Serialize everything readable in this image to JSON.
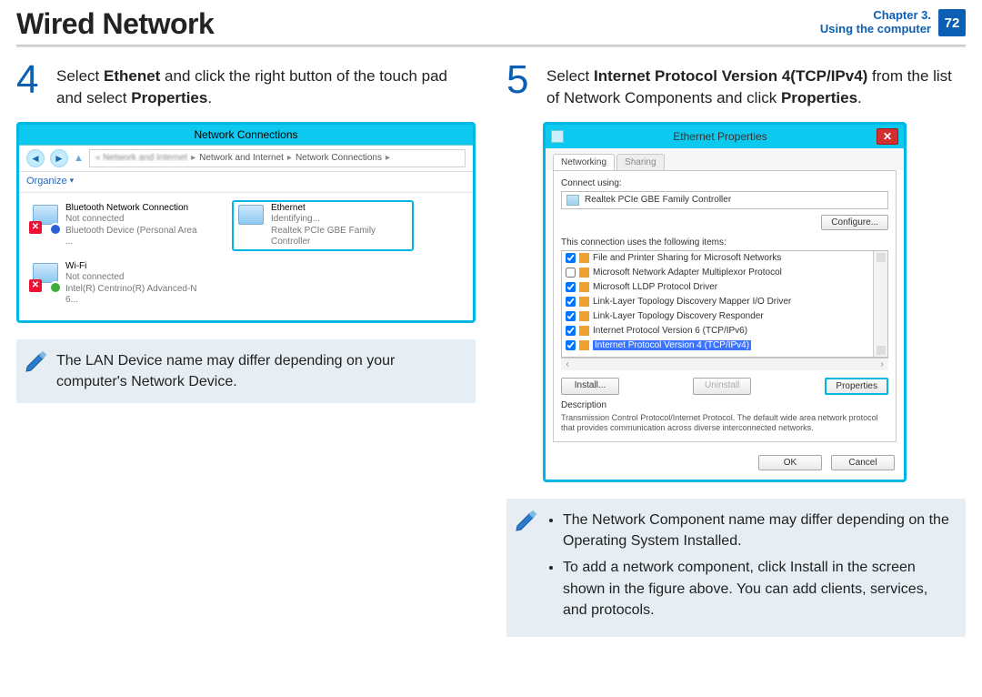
{
  "header": {
    "title": "Wired Network",
    "chapter_line1": "Chapter 3.",
    "chapter_line2": "Using the computer",
    "page": "72"
  },
  "step4": {
    "num": "4",
    "pre": "Select ",
    "bold1": "Ethenet",
    "mid": " and click the right button of the touch pad and select ",
    "bold2": "Properties",
    "post": "."
  },
  "step5": {
    "num": "5",
    "pre": "Select ",
    "bold1": "Internet Protocol Version 4(TCP/IPv4)",
    "mid": " from the list of Network Components and click ",
    "bold2": "Properties",
    "post": "."
  },
  "note_left": "The LAN Device name may differ depending on your computer's Network Device.",
  "note_right": {
    "b1": "The Network Component name may differ depending on the Operating System Installed.",
    "b2": "To add a network component, click Install in the screen shown in the figure above. You can add clients, services, and protocols."
  },
  "nc": {
    "title": "Network Connections",
    "crumb2": "Network and Internet",
    "crumb3": "Network Connections",
    "organize": "Organize",
    "items": [
      {
        "name": "Bluetooth Network Connection",
        "status": "Not connected",
        "device": "Bluetooth Device (Personal Area ...",
        "selected": false,
        "sub": "bt"
      },
      {
        "name": "Ethernet",
        "status": "Identifying...",
        "device": "Realtek PCIe GBE Family Controller",
        "selected": true,
        "sub": ""
      },
      {
        "name": "Wi-Fi",
        "status": "Not connected",
        "device": "Intel(R) Centrino(R) Advanced-N 6...",
        "selected": false,
        "sub": "wifi"
      }
    ]
  },
  "ep": {
    "title": "Ethernet Properties",
    "tab1": "Networking",
    "tab2": "Sharing",
    "connect_using_label": "Connect using:",
    "adapter": "Realtek PCIe GBE Family Controller",
    "configure": "Configure...",
    "items_label": "This connection uses the following items:",
    "components": [
      {
        "label": "File and Printer Sharing for Microsoft Networks",
        "checked": true,
        "selected": false
      },
      {
        "label": "Microsoft Network Adapter Multiplexor Protocol",
        "checked": false,
        "selected": false
      },
      {
        "label": "Microsoft LLDP Protocol Driver",
        "checked": true,
        "selected": false
      },
      {
        "label": "Link-Layer Topology Discovery Mapper I/O Driver",
        "checked": true,
        "selected": false
      },
      {
        "label": "Link-Layer Topology Discovery Responder",
        "checked": true,
        "selected": false
      },
      {
        "label": "Internet Protocol Version 6 (TCP/IPv6)",
        "checked": true,
        "selected": false
      },
      {
        "label": "Internet Protocol Version 4 (TCP/IPv4)",
        "checked": true,
        "selected": true
      }
    ],
    "install": "Install...",
    "uninstall": "Uninstall",
    "properties": "Properties",
    "desc_label": "Description",
    "desc_text": "Transmission Control Protocol/Internet Protocol. The default wide area network protocol that provides communication across diverse interconnected networks.",
    "ok": "OK",
    "cancel": "Cancel"
  }
}
